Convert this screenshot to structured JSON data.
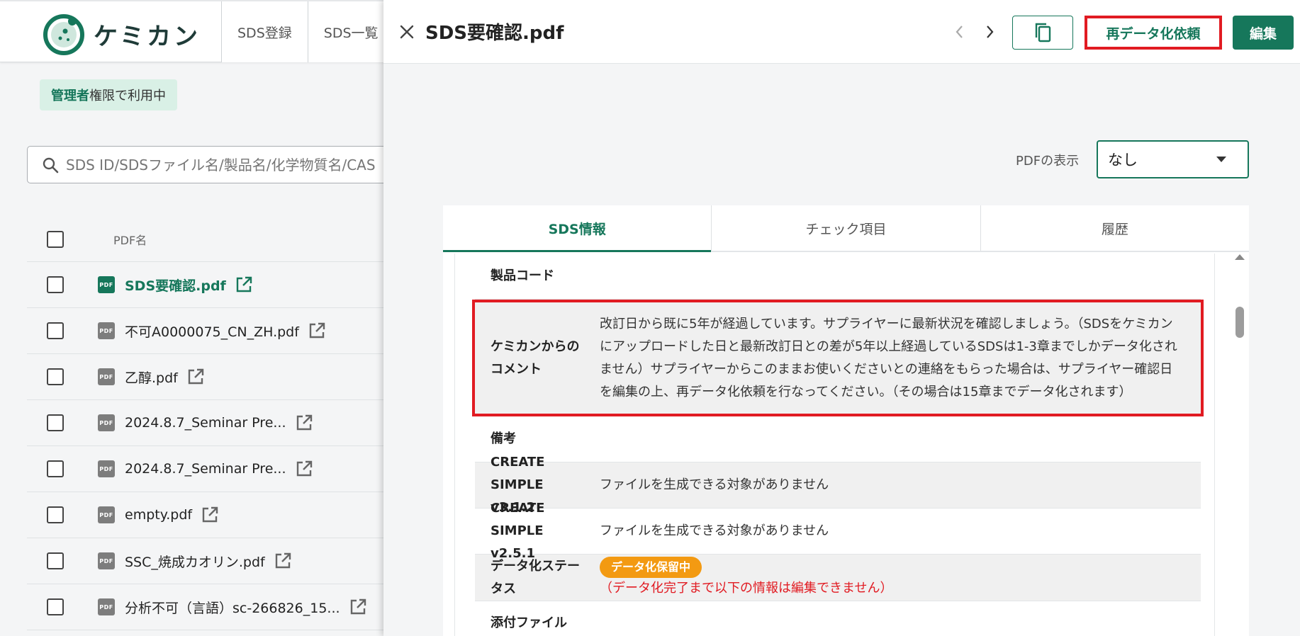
{
  "app": {
    "logo_text": "ケミカン",
    "nav_tabs": [
      "SDS登録",
      "SDS一覧"
    ],
    "role_badge": {
      "strong": "管理者",
      "rest": "権限で利用中"
    },
    "search": {
      "placeholder": "SDS ID/SDSファイル名/製品名/化学物質名/CAS"
    },
    "list": {
      "column_header": "PDF名",
      "pdf_badge": "PDF",
      "rows": [
        {
          "name": "SDS要確認.pdf",
          "active": true
        },
        {
          "name": "不可A0000075_CN_ZH.pdf"
        },
        {
          "name": "乙醇.pdf"
        },
        {
          "name": "2024.8.7_Seminar Pre..."
        },
        {
          "name": "2024.8.7_Seminar Pre..."
        },
        {
          "name": "empty.pdf"
        },
        {
          "name": "SSC_焼成カオリン.pdf"
        },
        {
          "name": "分析不可（言語）sc-266826_15..."
        }
      ]
    }
  },
  "drawer": {
    "title": "SDS要確認.pdf",
    "redata_label": "再データ化依頼",
    "edit_label": "編集",
    "pdf_display_label": "PDFの表示",
    "pdf_display_value": "なし",
    "tabs": [
      "SDS情報",
      "チェック項目",
      "履歴"
    ],
    "active_tab": 0,
    "rows": {
      "product_code": {
        "label": "製品コード",
        "value": ""
      },
      "comment": {
        "label_line1": "ケミカンからの",
        "label_line2": "コメント",
        "value": "改訂日から既に5年が経過しています。サプライヤーに最新状況を確認しましょう。（SDSをケミカンにアップロードした日と最新改訂日との差が5年以上経過しているSDSは1-3章までしかデータ化されません）サプライヤーからこのままお使いくださいとの連絡をもらった場合は、サプライヤー確認日を編集の上、再データ化依頼を行なってください。（その場合は15章までデータ化されます）"
      },
      "remarks": {
        "label": "備考",
        "value": ""
      },
      "create_simple_312": {
        "label_line1": "CREATE",
        "label_line2": "SIMPLE v3.1.2",
        "value": "ファイルを生成できる対象がありません"
      },
      "create_simple_251": {
        "label_line1": "CREATE",
        "label_line2": "SIMPLE v2.5.1",
        "value": "ファイルを生成できる対象がありません"
      },
      "data_status": {
        "label_line1": "データ化ステー",
        "label_line2": "タス",
        "badge": "データ化保留中",
        "note": "（データ化完了まで以下の情報は編集できません）"
      },
      "attachments": {
        "label": "添付ファイル"
      }
    }
  },
  "colors": {
    "brand_green": "#16775b",
    "highlight_red": "#e11b22",
    "status_orange": "#f39a12"
  }
}
